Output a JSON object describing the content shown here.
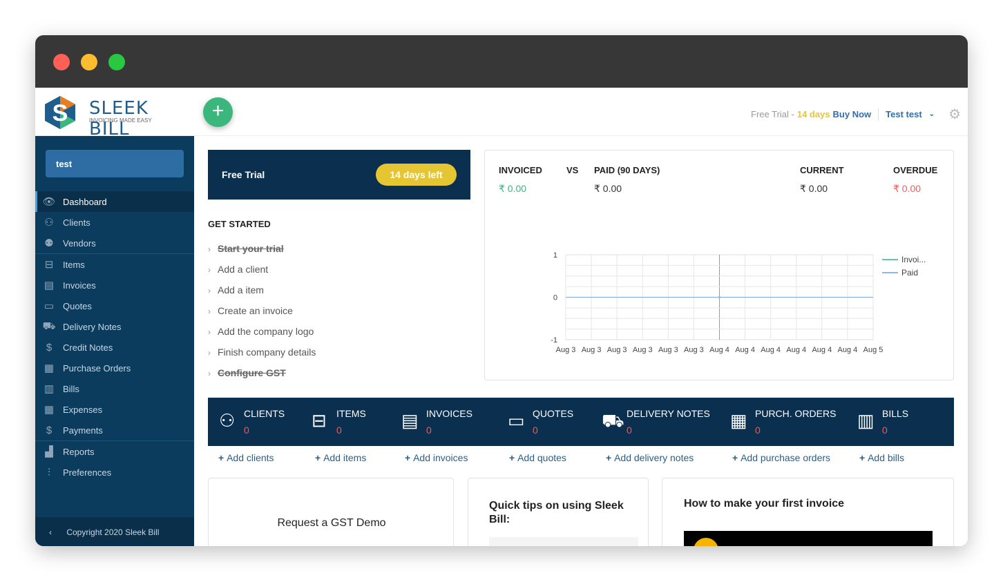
{
  "brand": {
    "name": "SLEEK BILL",
    "tagline": "INVOICING MADE EASY"
  },
  "header": {
    "trial_label": "Free Trial -",
    "trial_days": "14 days",
    "buy_now": "Buy Now",
    "user": "Test test"
  },
  "sidebar": {
    "company": "test",
    "items": [
      {
        "label": "Dashboard",
        "icon": "eye-icon"
      },
      {
        "label": "Clients",
        "icon": "users-icon"
      },
      {
        "label": "Vendors",
        "icon": "vendor-icon"
      },
      {
        "label": "Items",
        "icon": "basket-icon"
      },
      {
        "label": "Invoices",
        "icon": "invoice-icon"
      },
      {
        "label": "Quotes",
        "icon": "quote-icon"
      },
      {
        "label": "Delivery Notes",
        "icon": "truck-icon"
      },
      {
        "label": "Credit Notes",
        "icon": "dollar-doc-icon"
      },
      {
        "label": "Purchase Orders",
        "icon": "purchase-order-icon"
      },
      {
        "label": "Bills",
        "icon": "bill-icon"
      },
      {
        "label": "Expenses",
        "icon": "calculator-icon"
      },
      {
        "label": "Payments",
        "icon": "dollar-icon"
      },
      {
        "label": "Reports",
        "icon": "chart-icon"
      },
      {
        "label": "Preferences",
        "icon": "sliders-icon"
      }
    ],
    "copyright": "Copyright 2020 Sleek Bill"
  },
  "trial_banner": {
    "title": "Free Trial",
    "badge": "14 days left"
  },
  "get_started": {
    "title": "GET STARTED",
    "items": [
      {
        "label": "Start your trial",
        "done": true
      },
      {
        "label": "Add a client",
        "done": false
      },
      {
        "label": "Add a item",
        "done": false
      },
      {
        "label": "Create an invoice",
        "done": false
      },
      {
        "label": "Add the company logo",
        "done": false
      },
      {
        "label": "Finish company details",
        "done": false
      },
      {
        "label": "Configure GST",
        "done": true
      }
    ]
  },
  "summary": {
    "invoiced_label": "INVOICED",
    "vs": "VS",
    "paid_label": "PAID (90 DAYS)",
    "current_label": "CURRENT",
    "overdue_label": "OVERDUE",
    "invoiced": "₹ 0.00",
    "paid": "₹ 0.00",
    "current": "₹ 0.00",
    "overdue": "₹ 0.00"
  },
  "chart_data": {
    "type": "line",
    "x": [
      "Aug 3",
      "Aug 3",
      "Aug 3",
      "Aug 3",
      "Aug 3",
      "Aug 3",
      "Aug 4",
      "Aug 4",
      "Aug 4",
      "Aug 4",
      "Aug 4",
      "Aug 4",
      "Aug 5"
    ],
    "series": [
      {
        "name": "Invoi...",
        "color": "#5cc9a7",
        "values": [
          0,
          0,
          0,
          0,
          0,
          0,
          0,
          0,
          0,
          0,
          0,
          0,
          0
        ]
      },
      {
        "name": "Paid",
        "color": "#8ab6ea",
        "values": [
          0,
          0,
          0,
          0,
          0,
          0,
          0,
          0,
          0,
          0,
          0,
          0,
          0
        ]
      }
    ],
    "yticks": [
      "1",
      "0",
      "-1"
    ],
    "ylim": [
      -1,
      1
    ],
    "grid": true,
    "legend": "right"
  },
  "stats": [
    {
      "label": "CLIENTS",
      "value": "0",
      "icon": "users-icon",
      "add": "Add clients"
    },
    {
      "label": "ITEMS",
      "value": "0",
      "icon": "basket-icon",
      "add": "Add items"
    },
    {
      "label": "INVOICES",
      "value": "0",
      "icon": "invoice-icon",
      "add": "Add invoices"
    },
    {
      "label": "QUOTES",
      "value": "0",
      "icon": "quote-icon",
      "add": "Add quotes"
    },
    {
      "label": "DELIVERY NOTES",
      "value": "0",
      "icon": "truck-icon",
      "add": "Add delivery notes"
    },
    {
      "label": "PURCH. ORDERS",
      "value": "0",
      "icon": "purchase-order-icon",
      "add": "Add purchase orders"
    },
    {
      "label": "BILLS",
      "value": "0",
      "icon": "bill-icon",
      "add": "Add bills"
    }
  ],
  "bottom": {
    "gst_demo": "Request a GST Demo",
    "tips": "Quick tips on using Sleek Bill:",
    "howto": "How to make your first invoice"
  }
}
